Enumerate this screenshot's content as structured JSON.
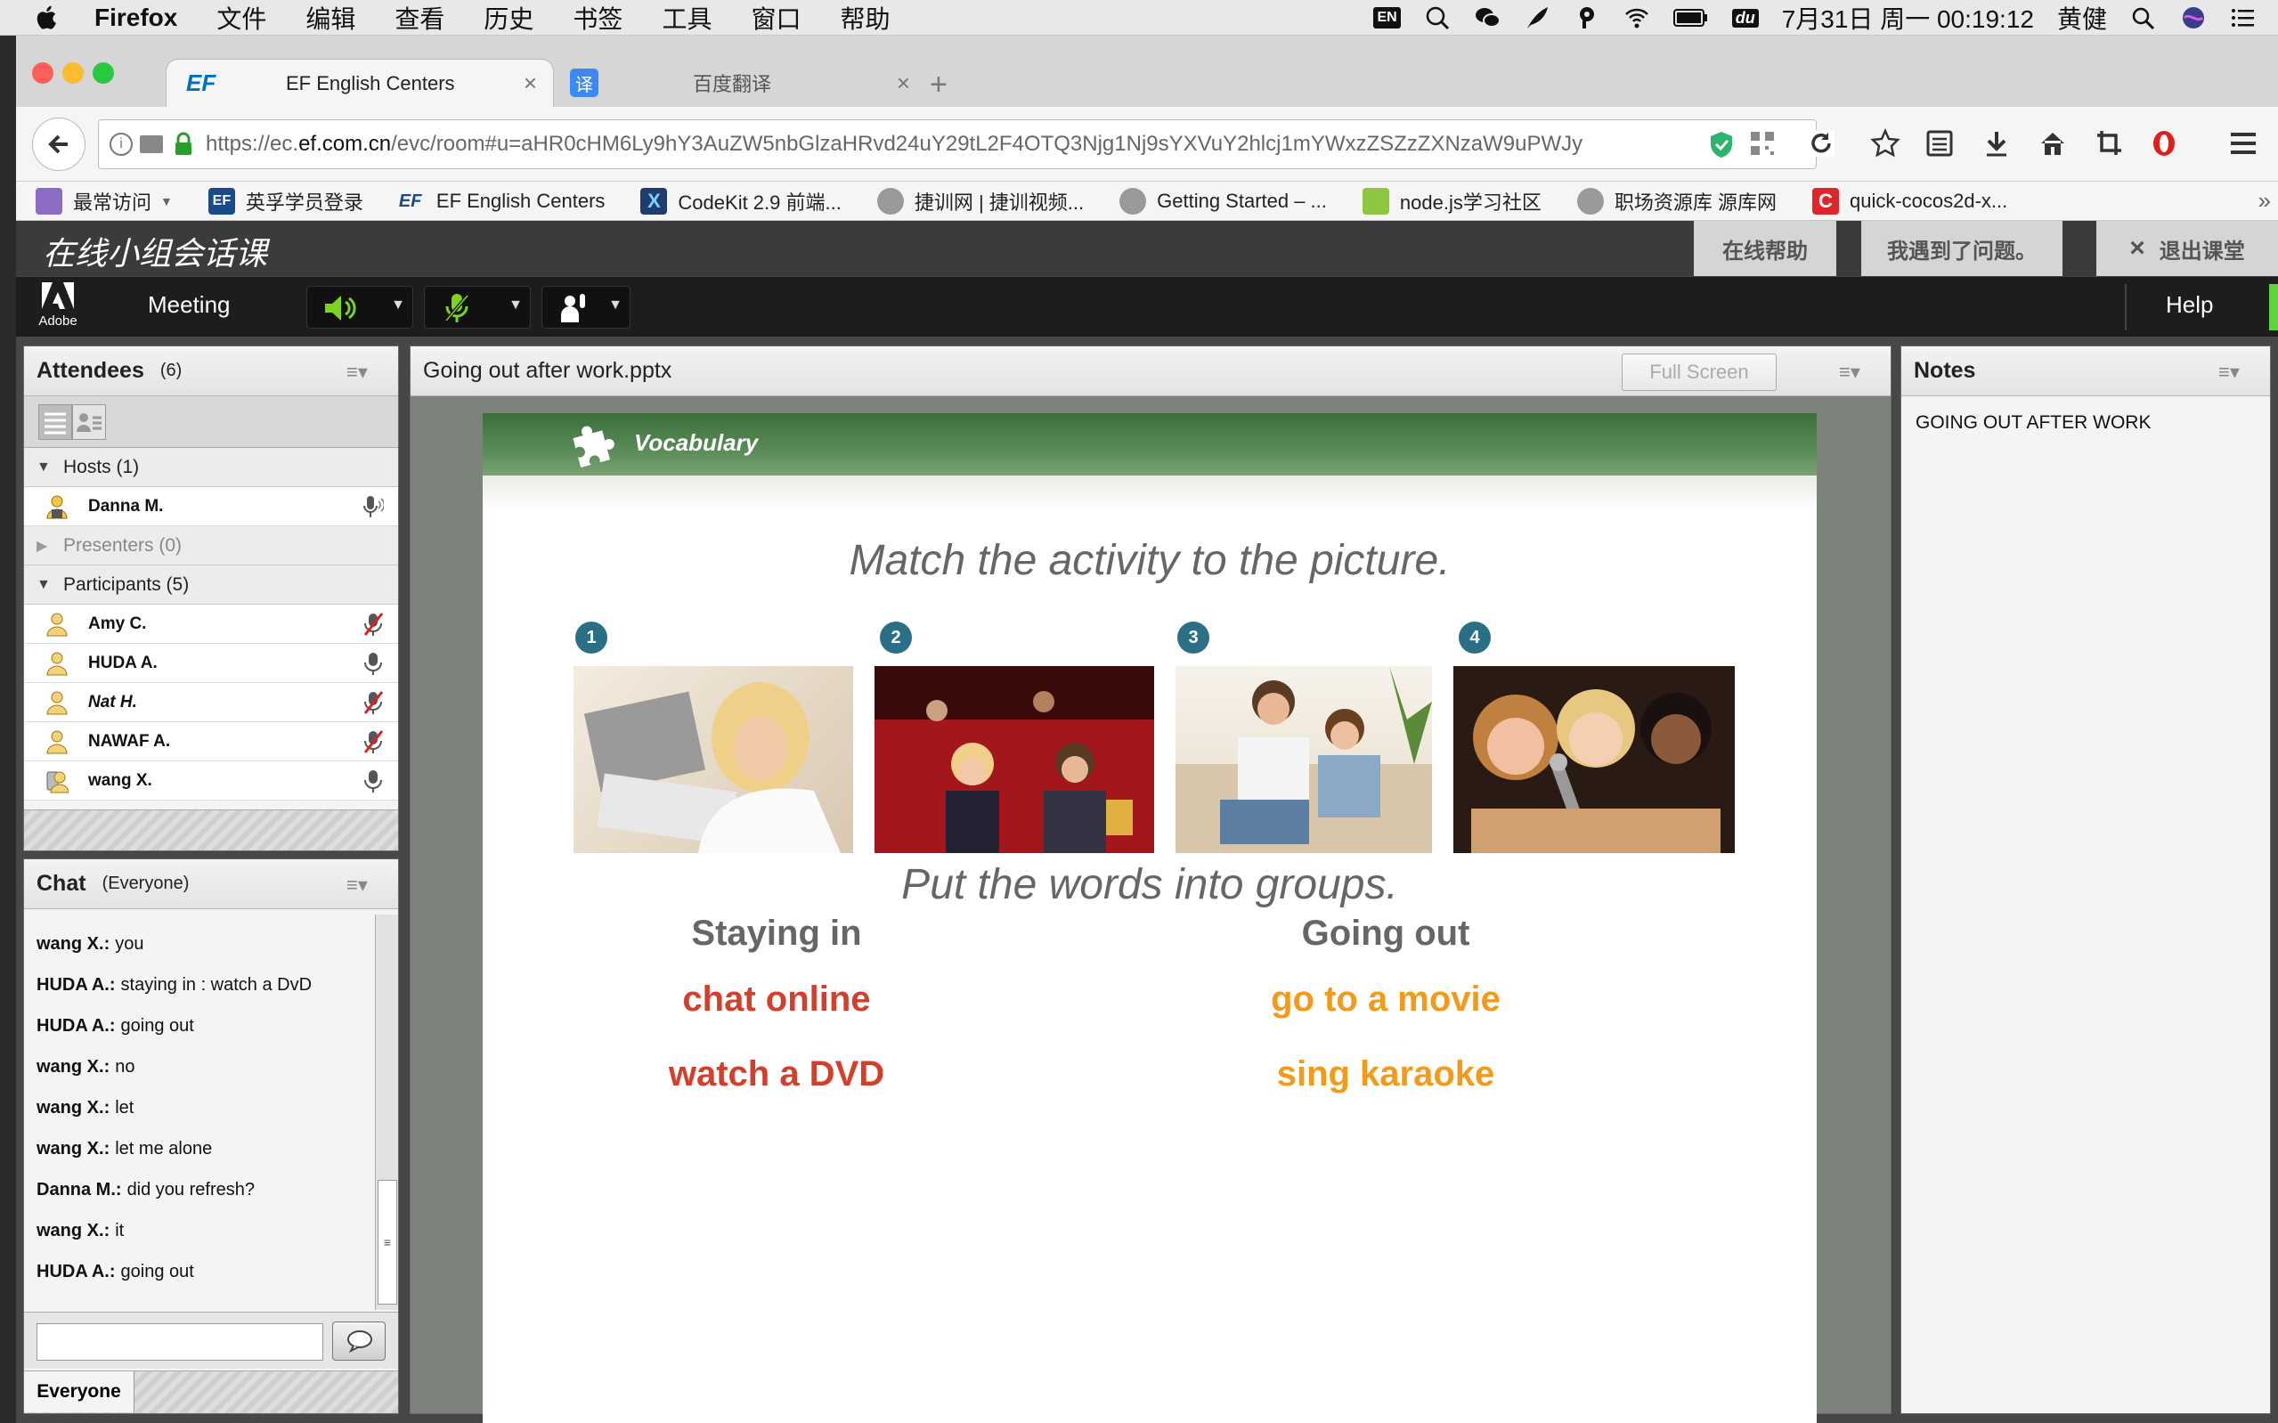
{
  "menubar": {
    "app": "Firefox",
    "items": [
      "文件",
      "编辑",
      "查看",
      "历史",
      "书签",
      "工具",
      "窗口",
      "帮助"
    ],
    "input_source": "EN",
    "clock": "7月31日 周一  00:19:12",
    "user": "黄健"
  },
  "browser": {
    "tabs": [
      {
        "label": "EF English Centers",
        "icon": "EF",
        "active": true
      },
      {
        "label": "百度翻译",
        "icon": "译",
        "active": false
      }
    ],
    "url_prefix": "https://ec.",
    "url_host": "ef.com.cn",
    "url_rest": "/evc/room#u=aHR0cHM6Ly9hY3AuZW5nbGlzaHRvd24uY29tL2F4OTQ3Njg1Nj9sYXVuY2hlcj1mYWxzZSZzZXNzaW9uPWJy",
    "bookmarks": [
      {
        "label": "最常访问",
        "icon": "star-folder-icon"
      },
      {
        "label": "英孚学员登录",
        "icon": "EF"
      },
      {
        "label": "EF English Centers",
        "icon": "EF"
      },
      {
        "label": "CodeKit 2.9 前端...",
        "icon": "codekit-icon"
      },
      {
        "label": "捷训网 | 捷训视频...",
        "icon": "globe-icon"
      },
      {
        "label": "Getting Started – ...",
        "icon": "globe-icon"
      },
      {
        "label": "node.js学习社区",
        "icon": "node-icon"
      },
      {
        "label": "职场资源库 源库网",
        "icon": "globe-icon"
      },
      {
        "label": "quick-cocos2d-x...",
        "icon": "cocos-icon"
      }
    ]
  },
  "app": {
    "title": "在线小组会话课",
    "help_online": "在线帮助",
    "report_problem": "我遇到了问题。",
    "exit": "退出课堂",
    "adobe_label": "Adobe",
    "meeting_menu": "Meeting",
    "help": "Help"
  },
  "attendees": {
    "title": "Attendees",
    "count": "(6)",
    "groups": {
      "hosts": "Hosts (1)",
      "presenters": "Presenters (0)",
      "participants": "Participants (5)"
    },
    "hosts": [
      "Danna M."
    ],
    "participants": [
      "Amy C.",
      "HUDA A.",
      "Nat H.",
      "NAWAF A.",
      "wang X."
    ]
  },
  "chat": {
    "title": "Chat",
    "scope": "(Everyone)",
    "messages": [
      {
        "name": "wang X.:",
        "text": "you"
      },
      {
        "name": "HUDA A.:",
        "text": "staying in : watch a DvD"
      },
      {
        "name": "HUDA A.:",
        "text": "going out"
      },
      {
        "name": "wang X.:",
        "text": "no"
      },
      {
        "name": "wang X.:",
        "text": "let"
      },
      {
        "name": "wang X.:",
        "text": "let me alone"
      },
      {
        "name": "Danna M.:",
        "text": "did you refresh?"
      },
      {
        "name": "wang X.:",
        "text": "it"
      },
      {
        "name": "HUDA A.:",
        "text": "going out"
      }
    ],
    "input_value": "",
    "audience": "Everyone"
  },
  "share": {
    "filename": "Going out after work.pptx",
    "fullscreen": "Full Screen"
  },
  "slide": {
    "section": "Vocabulary",
    "heading1": "Match the activity to the picture.",
    "numbers": [
      "1",
      "2",
      "3",
      "4"
    ],
    "heading2": "Put the words into groups.",
    "group_left": "Staying in",
    "group_right": "Going out",
    "left_words": [
      "chat online",
      "watch a DVD"
    ],
    "right_words": [
      "go to a movie",
      "sing karaoke"
    ],
    "colors": {
      "left": "#d2402b",
      "right": "#f39a1b",
      "heading": "#666666"
    }
  },
  "notes": {
    "title": "Notes",
    "body": "GOING OUT AFTER WORK"
  }
}
